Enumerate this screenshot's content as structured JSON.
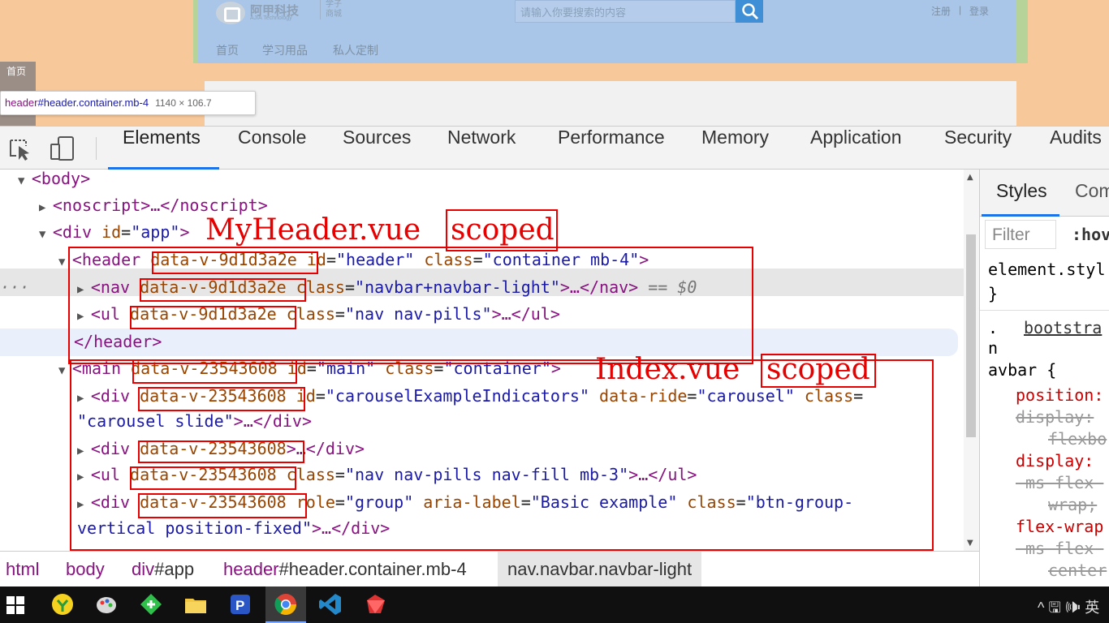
{
  "page": {
    "logo_text": "阿甲科技",
    "logo_sub": "AJIA Technology",
    "logo_tag": "学子商城",
    "search_placeholder": "请输入你要搜索的内容",
    "login_link": "注册",
    "login_sep": "|",
    "signup_link": "登录",
    "nav": [
      "首页",
      "学习用品",
      "私人定制"
    ],
    "side_tab": "首页"
  },
  "tooltip": {
    "tag": "header",
    "selector": "#header.container.mb-4",
    "size": "1140 × 106.7"
  },
  "devtools": {
    "tabs": [
      "Elements",
      "Console",
      "Sources",
      "Network",
      "Performance",
      "Memory",
      "Application",
      "Security",
      "Audits"
    ],
    "active_tab": "Elements"
  },
  "tree": {
    "body_open": "<body>",
    "noscript": "<noscript>…</noscript>",
    "div_app_tag": "<div ",
    "div_app_attr": "id",
    "div_app_val": "\"app\"",
    "div_app_close": ">",
    "header_tag": "<header ",
    "header_attr_v": "data-v-9d1d3a2e",
    "header_id_attr": " id",
    "header_id_val": "\"header\"",
    "header_class_attr": " class",
    "header_class_val": "\"container mb-4\"",
    "nav_tag": "<nav ",
    "nav_attr_v": "data-v-9d1d3a2e",
    "nav_class_attr": " class",
    "nav_class_val": "\"navbar+navbar-light\"",
    "nav_end": ">…</nav>",
    "nav_eq": " == $0",
    "ul1_tag": "<ul ",
    "ul1_attr_v": "data-v-9d1d3a2e",
    "ul1_class_attr": " class",
    "ul1_class_val": "\"nav nav-pills\"",
    "ul1_end": ">…</ul>",
    "header_close": "</header>",
    "main_tag": "<main ",
    "main_attr_v": "data-v-23543608",
    "main_id_attr": " id",
    "main_id_val": "\"main\"",
    "main_class_attr": " class",
    "main_class_val": "\"container\"",
    "div1_tag": "<div ",
    "div1_attr_v": "data-v-23543608",
    "div1_id_attr": " id",
    "div1_id_val": "\"carouselExampleIndicators\"",
    "div1_ride_attr": " data-ride",
    "div1_ride_val": "\"carousel\"",
    "div1_class_attr": " class",
    "div1_class_val_a": "\"carousel slide\"",
    "div1_end": ">…</div>",
    "div2_tag": "<div ",
    "div2_attr_v": "data-v-23543608",
    "div2_end": ">…</div>",
    "ul2_tag": "<ul ",
    "ul2_attr_v": "data-v-23543608",
    "ul2_class_attr": " class",
    "ul2_class_val": "\"nav nav-pills nav-fill mb-3\"",
    "ul2_end": ">…</ul>",
    "div3_tag": "<div ",
    "div3_attr_v": "data-v-23543608",
    "div3_role_attr": " role",
    "div3_role_val": "\"group\"",
    "div3_aria_attr": " aria-label",
    "div3_aria_val": "\"Basic example\"",
    "div3_class_attr": " class",
    "div3_class_val_a": "\"btn-group-",
    "div3_class_val_b": "vertical position-fixed\"",
    "div3_end": ">…</div>",
    "ellipsis": "…"
  },
  "annotations": {
    "header_file": "MyHeader.vue",
    "header_scoped": "scoped",
    "main_file": "Index.vue",
    "main_scoped": "scoped"
  },
  "styles": {
    "tab": "Styles",
    "tab2": "Com",
    "filter": "Filter",
    "hov": ":hov",
    "element_style": "element.styl",
    "brace_close": "}",
    "dot": ".",
    "source": "bootstra",
    "n": "n",
    "avbar": "avbar {",
    "position": "position:",
    "display_s1": "display:",
    "flexbo": "flexbo",
    "display": "display:",
    "msflex1": "-ms-flex-",
    "wrap": "wrap;",
    "flexwrap": "flex-wrap",
    "msflex2": "-ms-flex-",
    "center": "center"
  },
  "breadcrumb": {
    "items": [
      {
        "tag": "html",
        "sel": ""
      },
      {
        "tag": "body",
        "sel": ""
      },
      {
        "tag": "div",
        "sel": "#app"
      },
      {
        "tag": "header",
        "sel": "#header.container.mb-4"
      },
      {
        "tag": "nav",
        "sel": ".navbar.navbar-light"
      }
    ]
  },
  "taskbar": {
    "tray_text": "^ 🖫 🕪 英"
  },
  "colors": {
    "accent": "#1a73e8",
    "annotation_red": "#e60000",
    "tag_purple": "#881280",
    "attr_brown": "#994500",
    "value_blue": "#1a1aa6"
  }
}
